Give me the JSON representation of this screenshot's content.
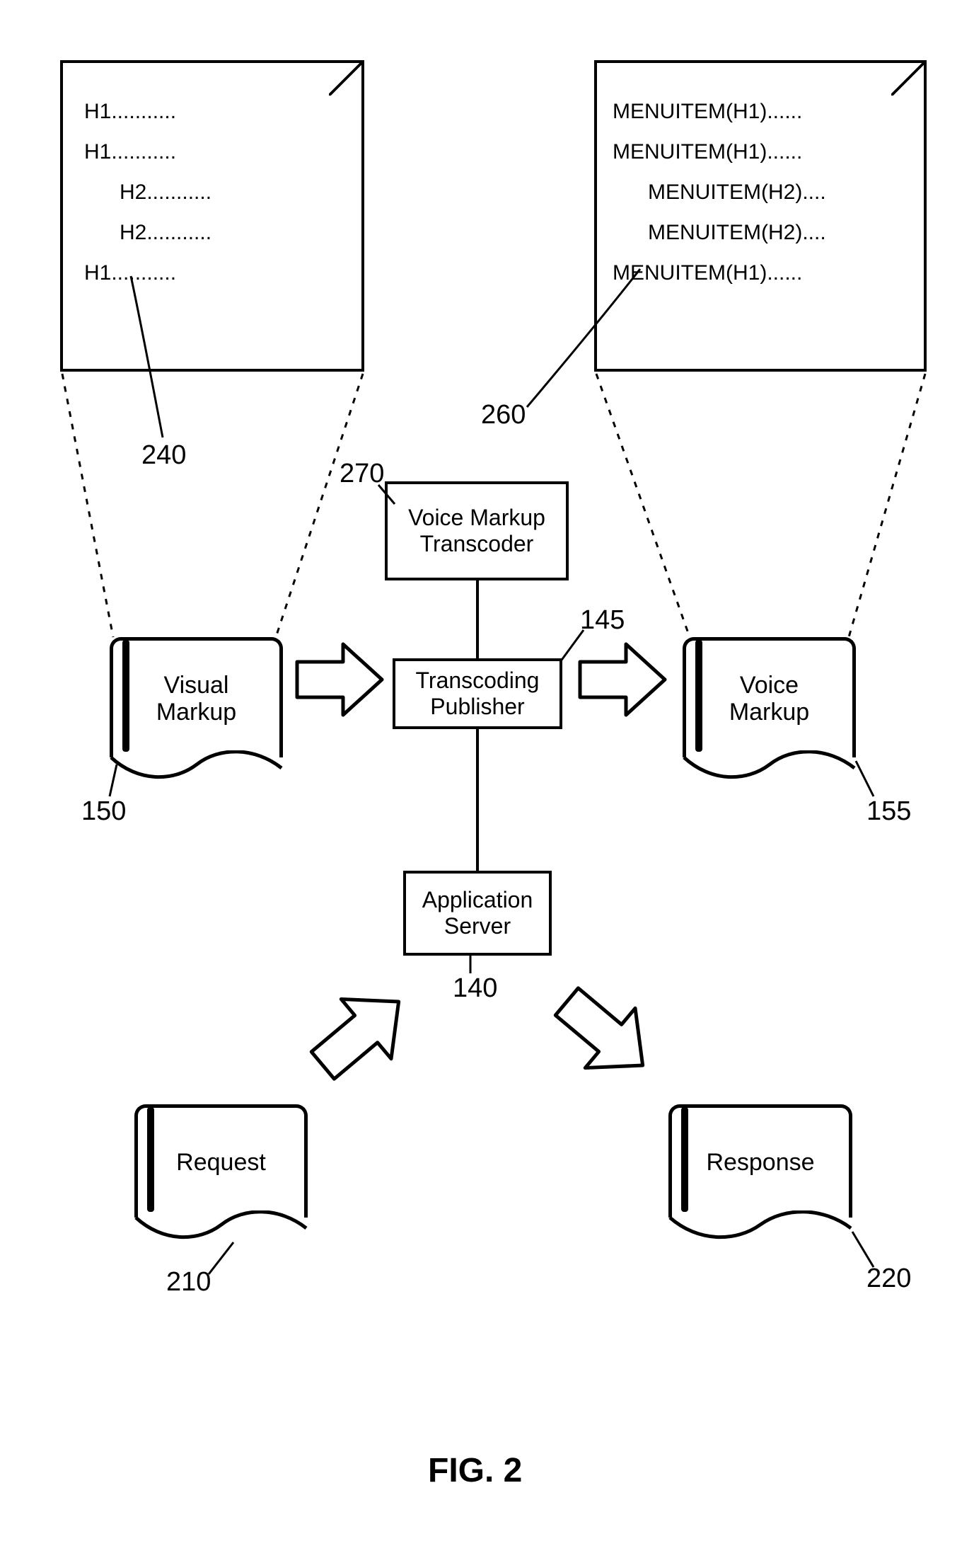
{
  "fig_label": "FIG. 2",
  "left_doc": {
    "lines": [
      {
        "text": "H1...........",
        "indent": 0
      },
      {
        "text": "H1...........",
        "indent": 0
      },
      {
        "text": "H2...........",
        "indent": 1
      },
      {
        "text": "H2...........",
        "indent": 1
      },
      {
        "text": "H1...........",
        "indent": 0
      }
    ]
  },
  "right_doc": {
    "lines": [
      {
        "text": "MENUITEM(H1)......",
        "indent": 0
      },
      {
        "text": "MENUITEM(H1)......",
        "indent": 0
      },
      {
        "text": "MENUITEM(H2)....",
        "indent": 1
      },
      {
        "text": "MENUITEM(H2)....",
        "indent": 1
      },
      {
        "text": "MENUITEM(H1)......",
        "indent": 0
      }
    ]
  },
  "scroll_visual": "Visual Markup",
  "scroll_voice": "Voice Markup",
  "scroll_request": "Request",
  "scroll_response": "Response",
  "box_transcoder": "Voice Markup Transcoder",
  "box_publisher": "Transcoding Publisher",
  "box_appserver": "Application Server",
  "refs": {
    "r240": "240",
    "r260": "260",
    "r270": "270",
    "r145": "145",
    "r140": "140",
    "r150": "150",
    "r155": "155",
    "r210": "210",
    "r220": "220"
  },
  "scroll_visual_l1": "Visual",
  "scroll_visual_l2": "Markup",
  "scroll_voice_l1": "Voice",
  "scroll_voice_l2": "Markup",
  "box_appserver_l1": "Application",
  "box_appserver_l2": "Server"
}
